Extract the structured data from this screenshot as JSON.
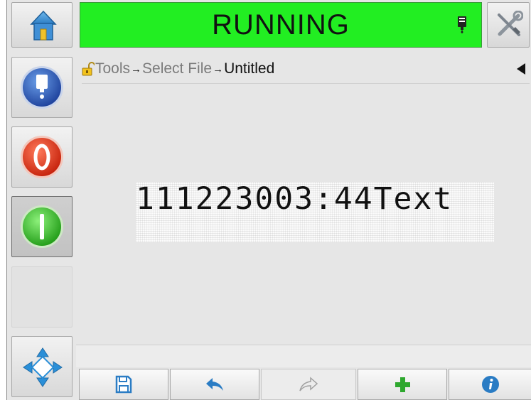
{
  "status": {
    "label": "RUNNING",
    "color": "#22ee22"
  },
  "breadcrumb": {
    "items": [
      {
        "label": "Tools"
      },
      {
        "label": "Select File"
      },
      {
        "label": "Untitled"
      }
    ],
    "separator": "→"
  },
  "preview": {
    "message": "111223003:44Text"
  },
  "sidebar": {
    "buttons": [
      {
        "name": "home-button",
        "icon": "home-icon"
      },
      {
        "name": "ink-system-button",
        "icon": "ink-drop-icon"
      },
      {
        "name": "stop-button",
        "icon": "stop-icon"
      },
      {
        "name": "start-button",
        "icon": "start-icon",
        "state": "pressed"
      },
      {
        "name": "navigate-button",
        "icon": "navigation-arrows-icon"
      }
    ]
  },
  "header_icons": [
    "printhead-icon",
    "tools-icon"
  ],
  "toolbar": {
    "buttons": [
      {
        "name": "save-button",
        "icon": "save-icon"
      },
      {
        "name": "undo-button",
        "icon": "undo-icon"
      },
      {
        "name": "redo-button",
        "icon": "redo-icon",
        "state": "disabled"
      },
      {
        "name": "add-button",
        "icon": "plus-icon"
      },
      {
        "name": "info-button",
        "icon": "info-icon"
      }
    ]
  }
}
